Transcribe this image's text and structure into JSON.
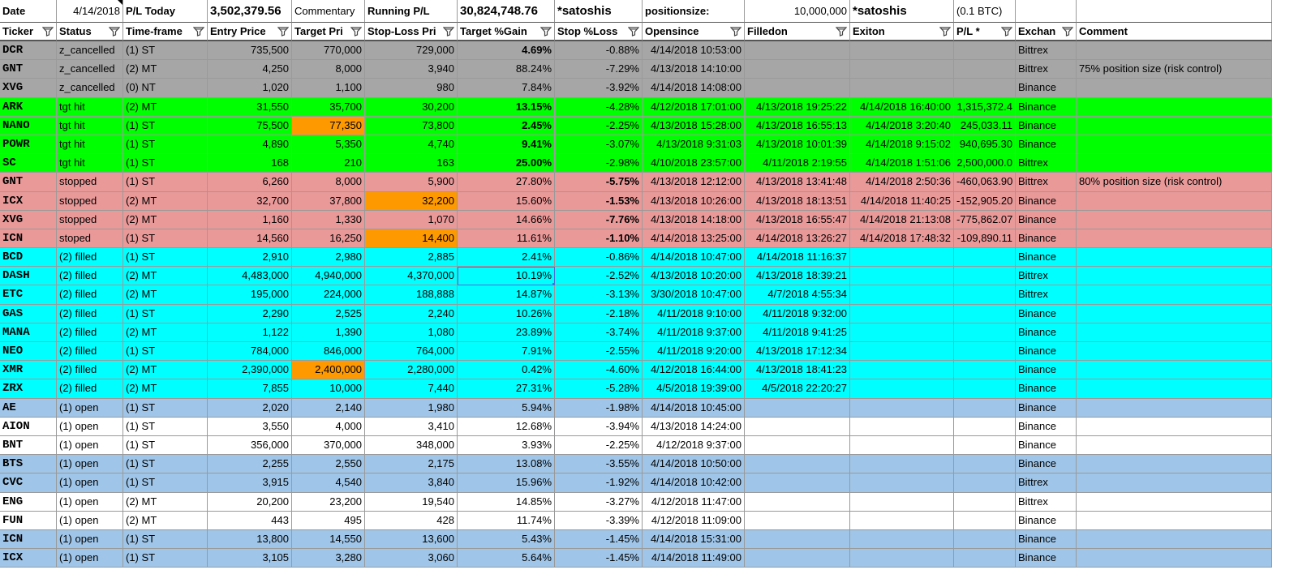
{
  "top": {
    "date_label": "Date",
    "date_value": "4/14/2018",
    "pl_today_label": "P/L Today",
    "pl_today_value": "3,502,379.56",
    "commentary_label": "Commentary",
    "running_pl_label": "Running P/L",
    "running_pl_value": "30,824,748.76",
    "unit1": "*satoshis",
    "positionsize_label": "positionsize:",
    "positionsize_value": "10,000,000",
    "unit2": "*satoshis",
    "btc_note": "(0.1 BTC)"
  },
  "headers": [
    "Ticker",
    "Status",
    "Time-frame",
    "Entry Price",
    "Target Pri",
    "Stop-Loss Pri",
    "Target %Gain",
    "Stop %Loss",
    "Opensince",
    "Filledon",
    "Exiton",
    "P/L *",
    "Exchan",
    "Comment"
  ],
  "colors": {
    "cancelled": "#a6a6a6",
    "tgt_hit": "#00ff00",
    "stopped": "#ea9999",
    "filled": "#00ffff",
    "open_blue": "#9fc5e8",
    "open_white": "#ffffff",
    "highlight": "#ff9900"
  },
  "rows": [
    {
      "cells": [
        "DCR",
        "z_cancelled",
        "(1) ST",
        "735,500",
        "770,000",
        "729,000",
        "4.69%",
        "-0.88%",
        "4/14/2018 10:53:00",
        "",
        "",
        "",
        "Bittrex",
        ""
      ],
      "color": "cancelled",
      "bold_gain": true
    },
    {
      "cells": [
        "GNT",
        "z_cancelled",
        "(2) MT",
        "4,250",
        "8,000",
        "3,940",
        "88.24%",
        "-7.29%",
        "4/13/2018 14:10:00",
        "",
        "",
        "",
        "Bittrex",
        "75% position size (risk control)"
      ],
      "color": "cancelled"
    },
    {
      "cells": [
        "XVG",
        "z_cancelled",
        "(0) NT",
        "1,020",
        "1,100",
        "980",
        "7.84%",
        "-3.92%",
        "4/14/2018 14:08:00",
        "",
        "",
        "",
        "Binance",
        ""
      ],
      "color": "cancelled"
    },
    {
      "cells": [
        "ARK",
        "tgt hit",
        "(2) MT",
        "31,550",
        "35,700",
        "30,200",
        "13.15%",
        "-4.28%",
        "4/12/2018 17:01:00",
        "4/13/2018 19:25:22",
        "4/14/2018 16:40:00",
        "1,315,372.4",
        "Binance",
        ""
      ],
      "color": "tgt_hit",
      "bold_gain": true
    },
    {
      "cells": [
        "NANO",
        "tgt hit",
        "(1) ST",
        "75,500",
        "77,350",
        "73,800",
        "2.45%",
        "-2.25%",
        "4/13/2018 15:28:00",
        "4/13/2018 16:55:13",
        "4/14/2018 3:20:40",
        "245,033.11",
        "Binance",
        ""
      ],
      "color": "tgt_hit",
      "bold_gain": true,
      "hl": [
        4
      ]
    },
    {
      "cells": [
        "POWR",
        "tgt hit",
        "(1) ST",
        "4,890",
        "5,350",
        "4,740",
        "9.41%",
        "-3.07%",
        "4/13/2018 9:31:03",
        "4/13/2018 10:01:39",
        "4/14/2018 9:15:02",
        "940,695.30",
        "Binance",
        ""
      ],
      "color": "tgt_hit",
      "bold_gain": true
    },
    {
      "cells": [
        "SC",
        "tgt hit",
        "(1) ST",
        "168",
        "210",
        "163",
        "25.00%",
        "-2.98%",
        "4/10/2018 23:57:00",
        "4/11/2018 2:19:55",
        "4/14/2018 1:51:06",
        "2,500,000.0",
        "Bittrex",
        ""
      ],
      "color": "tgt_hit",
      "bold_gain": true
    },
    {
      "cells": [
        "GNT",
        "stopped",
        "(1) ST",
        "6,260",
        "8,000",
        "5,900",
        "27.80%",
        "-5.75%",
        "4/13/2018 12:12:00",
        "4/13/2018 13:41:48",
        "4/14/2018 2:50:36",
        "-460,063.90",
        "Bittrex",
        "80% position size (risk control)"
      ],
      "color": "stopped",
      "bold_loss": true
    },
    {
      "cells": [
        "ICX",
        "stopped",
        "(2) MT",
        "32,700",
        "37,800",
        "32,200",
        "15.60%",
        "-1.53%",
        "4/13/2018 10:26:00",
        "4/13/2018 18:13:51",
        "4/14/2018 11:40:25",
        "-152,905.20",
        "Binance",
        ""
      ],
      "color": "stopped",
      "bold_loss": true,
      "hl": [
        5
      ]
    },
    {
      "cells": [
        "XVG",
        "stopped",
        "(2) MT",
        "1,160",
        "1,330",
        "1,070",
        "14.66%",
        "-7.76%",
        "4/13/2018 14:18:00",
        "4/13/2018 16:55:47",
        "4/14/2018 21:13:08",
        "-775,862.07",
        "Binance",
        ""
      ],
      "color": "stopped",
      "bold_loss": true
    },
    {
      "cells": [
        "ICN",
        "stoped",
        "(1) ST",
        "14,560",
        "16,250",
        "14,400",
        "11.61%",
        "-1.10%",
        "4/14/2018 13:25:00",
        "4/14/2018 13:26:27",
        "4/14/2018 17:48:32",
        "-109,890.11",
        "Binance",
        ""
      ],
      "color": "stopped",
      "bold_loss": true,
      "hl": [
        5
      ]
    },
    {
      "cells": [
        "BCD",
        "(2) filled",
        "(1) ST",
        "2,910",
        "2,980",
        "2,885",
        "2.41%",
        "-0.86%",
        "4/14/2018 10:47:00",
        "4/14/2018 11:16:37",
        "",
        "",
        "Binance",
        ""
      ],
      "color": "filled"
    },
    {
      "cells": [
        "DASH",
        "(2) filled",
        "(2) MT",
        "4,483,000",
        "4,940,000",
        "4,370,000",
        "10.19%",
        "-2.52%",
        "4/13/2018 10:20:00",
        "4/13/2018 18:39:21",
        "",
        "",
        "Bittrex",
        ""
      ],
      "color": "filled",
      "sel": 6
    },
    {
      "cells": [
        "ETC",
        "(2) filled",
        "(2) MT",
        "195,000",
        "224,000",
        "188,888",
        "14.87%",
        "-3.13%",
        "3/30/2018 10:47:00",
        "4/7/2018 4:55:34",
        "",
        "",
        "Bittrex",
        ""
      ],
      "color": "filled"
    },
    {
      "cells": [
        "GAS",
        "(2) filled",
        "(1) ST",
        "2,290",
        "2,525",
        "2,240",
        "10.26%",
        "-2.18%",
        "4/11/2018 9:10:00",
        "4/11/2018 9:32:00",
        "",
        "",
        "Binance",
        ""
      ],
      "color": "filled"
    },
    {
      "cells": [
        "MANA",
        "(2) filled",
        "(2) MT",
        "1,122",
        "1,390",
        "1,080",
        "23.89%",
        "-3.74%",
        "4/11/2018 9:37:00",
        "4/11/2018 9:41:25",
        "",
        "",
        "Binance",
        ""
      ],
      "color": "filled"
    },
    {
      "cells": [
        "NEO",
        "(2) filled",
        "(1) ST",
        "784,000",
        "846,000",
        "764,000",
        "7.91%",
        "-2.55%",
        "4/11/2018 9:20:00",
        "4/13/2018 17:12:34",
        "",
        "",
        "Binance",
        ""
      ],
      "color": "filled"
    },
    {
      "cells": [
        "XMR",
        "(2) filled",
        "(2) MT",
        "2,390,000",
        "2,400,000",
        "2,280,000",
        "0.42%",
        "-4.60%",
        "4/12/2018 16:44:00",
        "4/13/2018 18:41:23",
        "",
        "",
        "Binance",
        ""
      ],
      "color": "filled",
      "hl": [
        4
      ]
    },
    {
      "cells": [
        "ZRX",
        "(2) filled",
        "(2) MT",
        "7,855",
        "10,000",
        "7,440",
        "27.31%",
        "-5.28%",
        "4/5/2018 19:39:00",
        "4/5/2018 22:20:27",
        "",
        "",
        "Binance",
        ""
      ],
      "color": "filled"
    },
    {
      "cells": [
        "AE",
        "(1) open",
        "(1) ST",
        "2,020",
        "2,140",
        "1,980",
        "5.94%",
        "-1.98%",
        "4/14/2018 10:45:00",
        "",
        "",
        "",
        "Binance",
        ""
      ],
      "color": "open_blue"
    },
    {
      "cells": [
        "AION",
        "(1) open",
        "(1) ST",
        "3,550",
        "4,000",
        "3,410",
        "12.68%",
        "-3.94%",
        "4/13/2018 14:24:00",
        "",
        "",
        "",
        "Binance",
        ""
      ],
      "color": "open_white"
    },
    {
      "cells": [
        "BNT",
        "(1) open",
        "(1) ST",
        "356,000",
        "370,000",
        "348,000",
        "3.93%",
        "-2.25%",
        "4/12/2018 9:37:00",
        "",
        "",
        "",
        "Binance",
        ""
      ],
      "color": "open_white"
    },
    {
      "cells": [
        "BTS",
        "(1) open",
        "(1) ST",
        "2,255",
        "2,550",
        "2,175",
        "13.08%",
        "-3.55%",
        "4/14/2018 10:50:00",
        "",
        "",
        "",
        "Binance",
        ""
      ],
      "color": "open_blue"
    },
    {
      "cells": [
        "CVC",
        "(1) open",
        "(1) ST",
        "3,915",
        "4,540",
        "3,840",
        "15.96%",
        "-1.92%",
        "4/14/2018 10:42:00",
        "",
        "",
        "",
        "Bittrex",
        ""
      ],
      "color": "open_blue"
    },
    {
      "cells": [
        "ENG",
        "(1) open",
        "(2) MT",
        "20,200",
        "23,200",
        "19,540",
        "14.85%",
        "-3.27%",
        "4/12/2018 11:47:00",
        "",
        "",
        "",
        "Bittrex",
        ""
      ],
      "color": "open_white"
    },
    {
      "cells": [
        "FUN",
        "(1) open",
        "(2) MT",
        "443",
        "495",
        "428",
        "11.74%",
        "-3.39%",
        "4/12/2018 11:09:00",
        "",
        "",
        "",
        "Binance",
        ""
      ],
      "color": "open_white"
    },
    {
      "cells": [
        "ICN",
        "(1) open",
        "(1) ST",
        "13,800",
        "14,550",
        "13,600",
        "5.43%",
        "-1.45%",
        "4/14/2018 15:31:00",
        "",
        "",
        "",
        "Binance",
        ""
      ],
      "color": "open_blue"
    },
    {
      "cells": [
        "ICX",
        "(1) open",
        "(1) ST",
        "3,105",
        "3,280",
        "3,060",
        "5.64%",
        "-1.45%",
        "4/14/2018 11:49:00",
        "",
        "",
        "",
        "Binance",
        ""
      ],
      "color": "open_blue"
    }
  ]
}
